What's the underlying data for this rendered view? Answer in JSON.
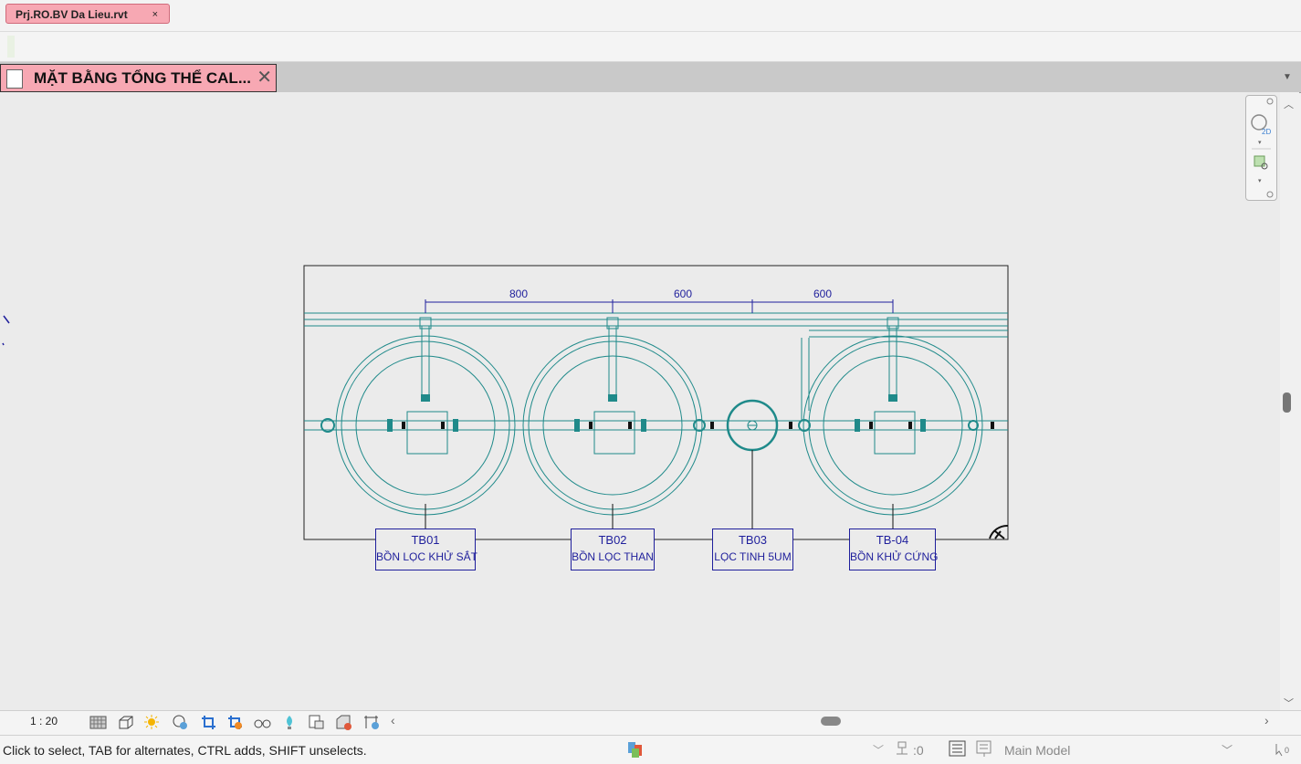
{
  "file_tab": {
    "title": "Prj.RO.BV Da Lieu.rvt",
    "close": "×"
  },
  "view_tab": {
    "title": "MẶT BẰNG TỔNG THỂ CAL...",
    "close": "✕"
  },
  "drawing": {
    "dimensions": [
      "800",
      "600",
      "600"
    ],
    "tags": [
      {
        "code": "TB01",
        "name": "BỒN LỌC KHỬ SẮT"
      },
      {
        "code": "TB02",
        "name": "BỒN LỌC THAN"
      },
      {
        "code": "TB03",
        "name": "LỌC TINH 5UM"
      },
      {
        "code": "TB-04",
        "name": "BỒN KHỬ CỨNG"
      }
    ]
  },
  "view_control_bar": {
    "scale": "1 : 20",
    "icons": [
      "detail-level-icon",
      "visual-style-icon",
      "sun-path-icon",
      "shadows-icon",
      "crop-view-icon",
      "show-crop-region-icon",
      "temporary-hide-icon",
      "reveal-hidden-icon",
      "temporary-view-properties-icon",
      "highlight-displacement-icon",
      "reveal-constraints-icon",
      "analytical-model-icon"
    ]
  },
  "status_bar": {
    "message": "Click to select, TAB for alternates, CTRL adds, SHIFT unselects.",
    "selection_count": ":0",
    "active_model": "Main Model"
  },
  "colors": {
    "tab_pink": "#f7a8b3",
    "pipe_teal": "#1f8a8a",
    "annotation_blue": "#1f1f9c"
  }
}
